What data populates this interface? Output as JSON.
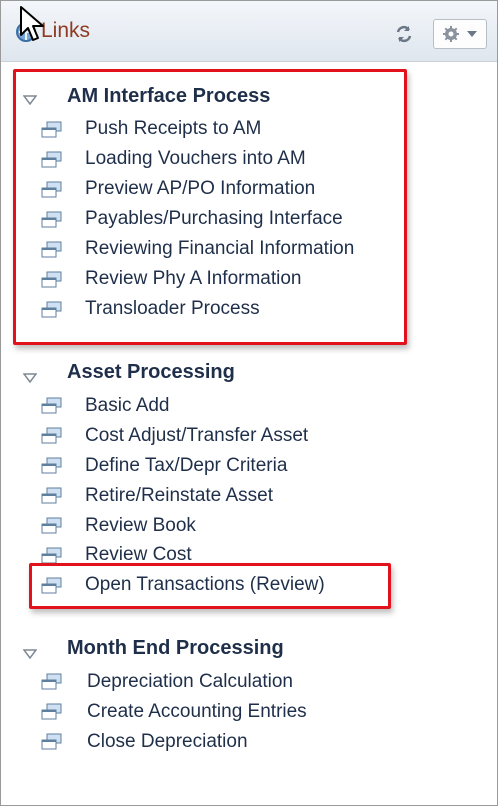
{
  "header": {
    "title": "Links"
  },
  "sections": [
    {
      "title": "AM Interface Process",
      "items": [
        "Push Receipts to AM",
        "Loading Vouchers into AM",
        "Preview AP/PO Information",
        "Payables/Purchasing Interface",
        "Reviewing Financial Information",
        "Review Phy A Information",
        "Transloader Process"
      ]
    },
    {
      "title": "Asset Processing",
      "items": [
        "Basic Add",
        "Cost Adjust/Transfer Asset",
        "Define Tax/Depr Criteria",
        "Retire/Reinstate Asset",
        "Review Book",
        "Review Cost",
        "Open Transactions (Review)"
      ]
    },
    {
      "title": "Month End Processing",
      "items": [
        "Depreciation Calculation",
        "Create Accounting Entries",
        "Close Depreciation"
      ]
    }
  ],
  "colors": {
    "header_title": "#8f3a22",
    "link_text": "#1f2f4a",
    "highlight_box": "#e2121c"
  },
  "icons": {
    "header": "links-icon",
    "refresh": "refresh-icon",
    "settings": "gear-icon",
    "collapse": "triangle-down-icon",
    "item": "portal-link-icon"
  }
}
